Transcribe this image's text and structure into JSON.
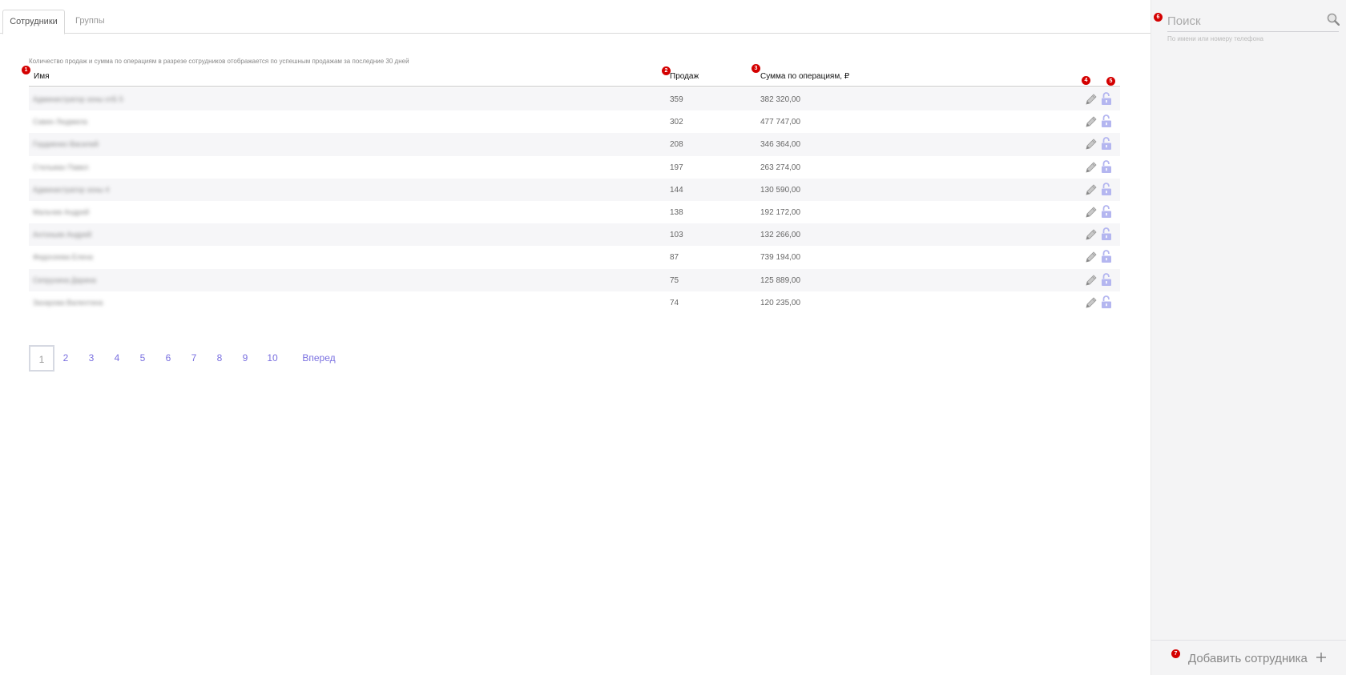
{
  "tabs": [
    {
      "label": "Сотрудники",
      "active": true
    },
    {
      "label": "Группы",
      "active": false
    }
  ],
  "note": "Количество продаж и сумма по операциям в разрезе сотрудников отображается по успешным продажам за последние 30 дней",
  "markers": [
    "1",
    "2",
    "3",
    "4",
    "5",
    "6",
    "7"
  ],
  "columns": {
    "name": "Имя",
    "sales": "Продаж",
    "sum": "Сумма по операциям, ₽"
  },
  "rows": [
    {
      "name": "Администратор зоны отБ 5",
      "sales": "359",
      "sum": "382 320,00"
    },
    {
      "name": "Савин Людмила",
      "sales": "302",
      "sum": "477 747,00"
    },
    {
      "name": "Гордиенко Василий",
      "sales": "208",
      "sum": "346 364,00"
    },
    {
      "name": "Стельмах Павел",
      "sales": "197",
      "sum": "263 274,00"
    },
    {
      "name": "Администратор зоны 4",
      "sales": "144",
      "sum": "130 590,00"
    },
    {
      "name": "Мальчев Андрей",
      "sales": "138",
      "sum": "192 172,00"
    },
    {
      "name": "Антоньев Андрей",
      "sales": "103",
      "sum": "132 266,00"
    },
    {
      "name": "Федосеева Елена",
      "sales": "87",
      "sum": "739 194,00"
    },
    {
      "name": "Сепрухина Дарина",
      "sales": "75",
      "sum": "125 889,00"
    },
    {
      "name": "Захарова Валентина",
      "sales": "74",
      "sum": "120 235,00"
    }
  ],
  "row_icons": {
    "edit": "pencil-icon",
    "lock": "lock-open-icon",
    "accent": "#b4b6f0",
    "edit_color": "#a8a8a8"
  },
  "pagination": {
    "pages": [
      "1",
      "2",
      "3",
      "4",
      "5",
      "6",
      "7",
      "8",
      "9",
      "10"
    ],
    "current": "1",
    "next": "Вперед"
  },
  "sidebar": {
    "search_placeholder": "Поиск",
    "search_hint": "По имени или номеру телефона",
    "add_label": "Добавить сотрудника"
  },
  "colors": {
    "link": "#7a70e0",
    "marker": "#d40000"
  }
}
